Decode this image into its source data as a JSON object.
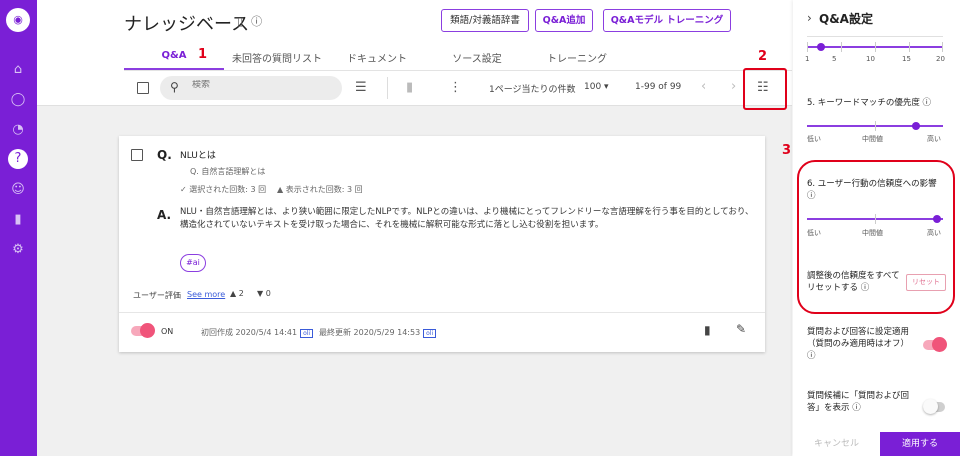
{
  "header": {
    "title": "ナレッジベース",
    "buttons": [
      "類語/対義語辞書",
      "Q&A追加",
      "Q&Aモデル トレーニング"
    ]
  },
  "tabs": [
    "Q&A",
    "未回答の質問リスト",
    "ドキュメント",
    "ソース設定",
    "トレーニング"
  ],
  "toolbar": {
    "search_placeholder": "検索",
    "per_page_label": "1ページ当たりの件数",
    "per_page_value": "100",
    "range": "1-99 of 99"
  },
  "card": {
    "q_label": "Q.",
    "question": "NLUとは",
    "alt_question": "Q.  自然言語理解とは",
    "selected_count": "選択された回数: 3 回",
    "shown_count": "表示された回数: 3 回",
    "a_label": "A.",
    "answer": "NLU・自然言語理解とは、より狭い範囲に限定したNLPです。NLPとの違いは、より機械にとってフレンドリーな言語理解を行う事を目的としており、構造化されていないテキストを受け取った場合に、それを機械に解釈可能な形式に落とし込む役割を担います。",
    "tag": "#ai",
    "rating_label": "ユーザー評価",
    "see_more": "See more",
    "likes": "2",
    "dislikes": "0",
    "toggle_label": "ON",
    "created": "初回作成 2020/5/4 14:41",
    "updated": "最終更新 2020/5/29 14:53",
    "badge": "oli"
  },
  "panel": {
    "title": "Q&A設定",
    "scale_labels": [
      "1",
      "5",
      "10",
      "15",
      "20"
    ],
    "scale_value": 2,
    "setting5_title": "5. キーワードマッチの優先度",
    "setting5_level": 0.8,
    "setting6_title": "6. ユーザー行動の信頼度への影響",
    "setting6_level": 0.95,
    "level_labels": [
      "低い",
      "中間値",
      "高い"
    ],
    "reset_text": "調整後の信頼度をすべてリセットする",
    "reset_button": "リセット",
    "apply_qa_text": "質問および回答に設定適用（質問のみ適用時はオフ）",
    "show_candidates_text": "質問候補に「質問および回答」を表示",
    "cancel": "キャンセル",
    "apply": "適用する"
  },
  "annotations": [
    "1",
    "2",
    "3"
  ],
  "colors": {
    "accent": "#7a1fd6",
    "annotation": "#e0001a",
    "toggle_on": "#f0547a"
  }
}
